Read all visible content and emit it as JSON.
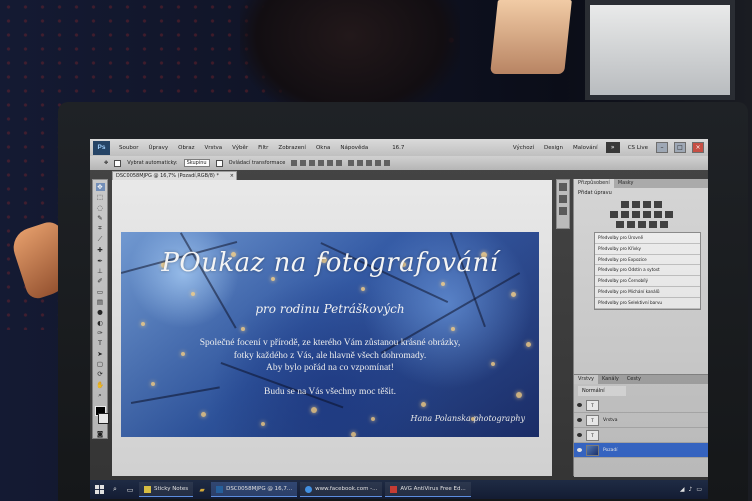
{
  "menu": {
    "logo": "Ps",
    "items": [
      "Soubor",
      "Úpravy",
      "Obraz",
      "Vrstva",
      "Výběr",
      "Filtr",
      "Zobrazení",
      "Okna",
      "Nápověda"
    ],
    "zoom": "16.7",
    "workspaces": [
      "Výchozí",
      "Design",
      "Malování"
    ],
    "cs_live": "CS Live"
  },
  "options": {
    "auto_select_label": "Vybrat automaticky:",
    "auto_select_value": "Skupinu",
    "transform_label": "Ovládací transformace"
  },
  "document": {
    "tab": "DSC0058MJPG @ 16,7% (Pozadí,RGB/8) *"
  },
  "voucher": {
    "title": "POukaz na fotografování",
    "subtitle": "pro rodinu Petráškových",
    "body_lines": [
      "Společné focení v přírodě, ze kterého Vám zůstanou krásné obrázky,",
      "fotky každého z Vás, ale hlavně všech dohromady.",
      "Aby bylo pořád na co vzpomínat!"
    ],
    "closing": "Budu se na Vás všechny moc těšit.",
    "signature": "Hana Polanska photography"
  },
  "adjustments": {
    "tabs": [
      "Přizpůsobení",
      "Masky"
    ],
    "heading": "Přidat úpravu",
    "presets": [
      "Předvolby pro Úrovně",
      "Předvolby pro Křivky",
      "Předvolby pro Expozice",
      "Předvolby pro Odstín a sytost",
      "Předvolby pro Černobílý",
      "Předvolby pro Michání kanálů",
      "Předvolby pro Selektivní barvu"
    ]
  },
  "layers": {
    "tabs": [
      "Vrstvy",
      "Kanály",
      "Cesty"
    ],
    "blend_mode": "Normální",
    "rows": [
      {
        "name": "",
        "thumb": "T"
      },
      {
        "name": "Vrstva",
        "thumb": "T"
      },
      {
        "name": "",
        "thumb": "T"
      },
      {
        "name": "Pozadí",
        "thumb": ""
      }
    ]
  },
  "taskbar": {
    "tasks": [
      {
        "label": "Sticky Notes",
        "active": false
      },
      {
        "label": "DSC0058MJPG @ 16,7...",
        "active": true
      },
      {
        "label": "www.facebook.com -...",
        "active": false
      },
      {
        "label": "AVG AntiVirus Free Ed...",
        "active": false
      }
    ]
  },
  "colors": {
    "accent": "#3a6ed6",
    "voucher_blue": "#2f58a8",
    "taskbar": "#16203a"
  }
}
